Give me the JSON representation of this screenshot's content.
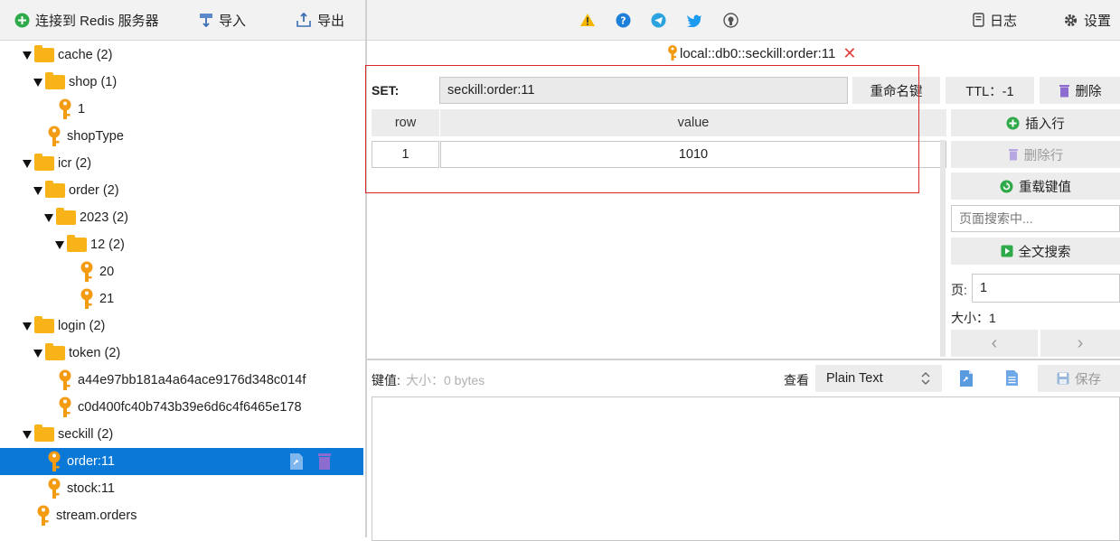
{
  "left_toolbar": {
    "connect_label": "连接到 Redis 服务器",
    "import_label": "导入",
    "export_label": "导出"
  },
  "tree": [
    {
      "label": "cache (2)",
      "type": "folder",
      "level": 0,
      "expanded": true
    },
    {
      "label": "shop (1)",
      "type": "folder",
      "level": 1,
      "expanded": true
    },
    {
      "label": "1",
      "type": "key",
      "level": 2
    },
    {
      "label": "shopType",
      "type": "key",
      "level": 1
    },
    {
      "label": "icr (2)",
      "type": "folder",
      "level": 0,
      "expanded": true
    },
    {
      "label": "order (2)",
      "type": "folder",
      "level": 1,
      "expanded": true
    },
    {
      "label": "2023 (2)",
      "type": "folder",
      "level": 2,
      "expanded": true
    },
    {
      "label": "12 (2)",
      "type": "folder",
      "level": 3,
      "expanded": true
    },
    {
      "label": "20",
      "type": "key",
      "level": 4
    },
    {
      "label": "21",
      "type": "key",
      "level": 4
    },
    {
      "label": "login (2)",
      "type": "folder",
      "level": 0,
      "expanded": true
    },
    {
      "label": "token (2)",
      "type": "folder",
      "level": 1,
      "expanded": true
    },
    {
      "label": "a44e97bb181a4a64ace9176d348c014f",
      "type": "key",
      "level": 2
    },
    {
      "label": "c0d400fc40b743b39e6d6c4f6465e178",
      "type": "key",
      "level": 2
    },
    {
      "label": "seckill (2)",
      "type": "folder",
      "level": 0,
      "expanded": true
    },
    {
      "label": "order:11",
      "type": "key",
      "level": 1,
      "selected": true
    },
    {
      "label": "stock:11",
      "type": "key",
      "level": 1
    },
    {
      "label": "stream.orders",
      "type": "key",
      "level": 0
    }
  ],
  "right_toolbar": {
    "log_label": "日志",
    "settings_label": "设置"
  },
  "tab": {
    "title": "local::db0::seckill:order:11"
  },
  "key_view": {
    "type_label": "SET:",
    "key_name": "seckill:order:11",
    "rename_label": "重命名键",
    "ttl_label": "TTL：-1",
    "delete_label": "删除",
    "table": {
      "columns": [
        "row",
        "value"
      ],
      "rows": [
        [
          "1",
          "1010"
        ]
      ]
    },
    "insert_row_label": "插入行",
    "delete_row_label": "删除行",
    "reload_label": "重载键值",
    "search_placeholder": "页面搜索中...",
    "full_search_label": "全文搜索",
    "page_label": "页:",
    "page_value": "1",
    "size_label": "大小：1",
    "prev_label": "‹",
    "next_label": "›"
  },
  "value_editor": {
    "label": "键值:",
    "size_hint": "大小：0 bytes",
    "view_label": "查看",
    "view_mode": "Plain Text",
    "save_label": "保存"
  },
  "colors": {
    "selected": "#0a78d7",
    "folder": "#f7b318",
    "key": "#f39c12",
    "highlight": "#d8262b",
    "green": "#2eaa4a"
  }
}
